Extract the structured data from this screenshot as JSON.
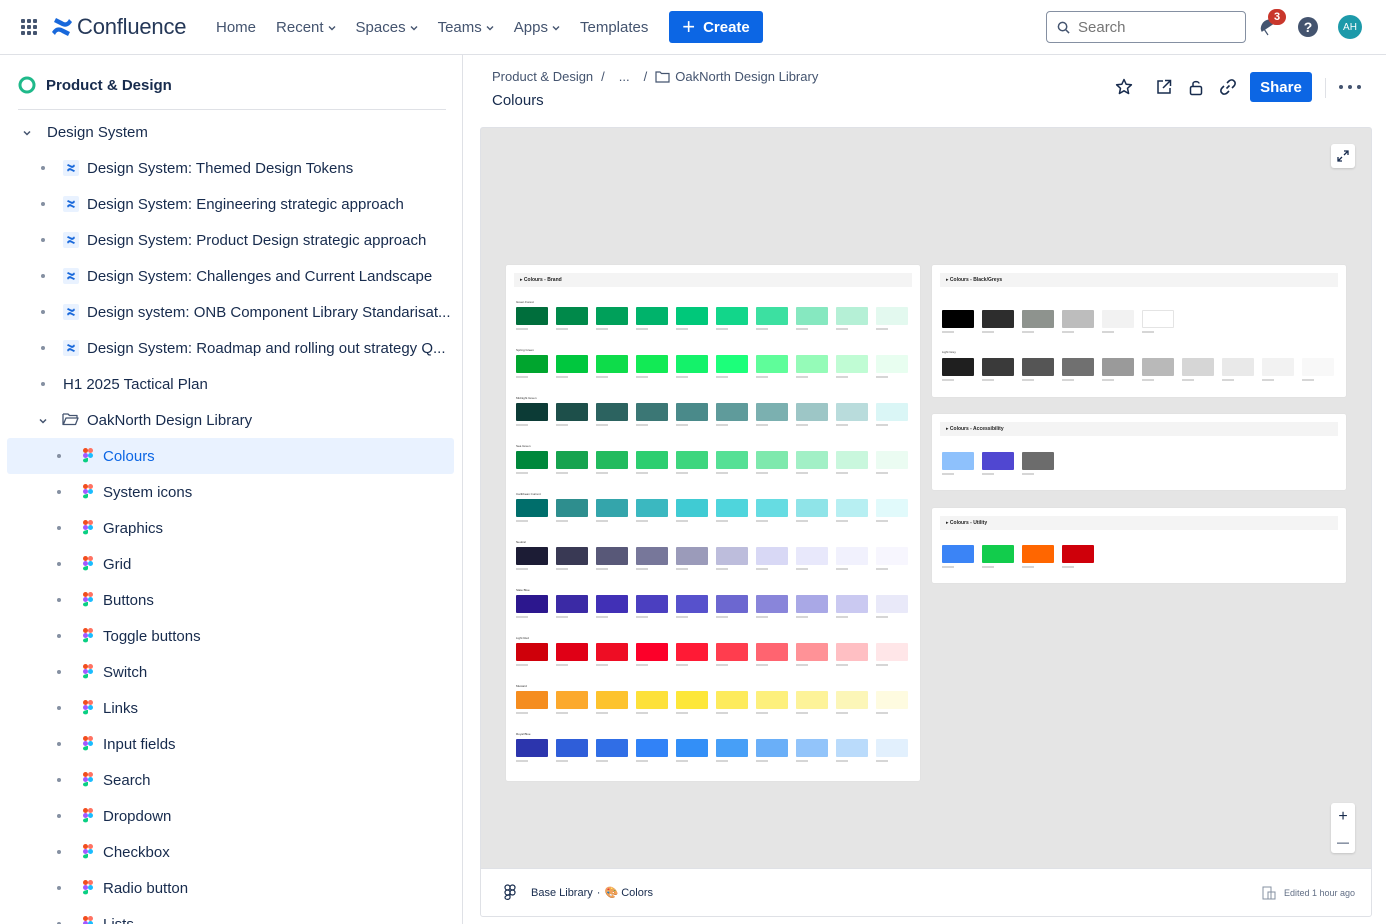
{
  "topnav": {
    "logo_text": "Confluence",
    "items": [
      {
        "label": "Home",
        "has_dropdown": false
      },
      {
        "label": "Recent",
        "has_dropdown": true
      },
      {
        "label": "Spaces",
        "has_dropdown": true
      },
      {
        "label": "Teams",
        "has_dropdown": true
      },
      {
        "label": "Apps",
        "has_dropdown": true
      },
      {
        "label": "Templates",
        "has_dropdown": false
      }
    ],
    "create_label": "Create",
    "search_placeholder": "Search",
    "notification_count": "3",
    "help_label": "?",
    "avatar_initials": "AH",
    "accent": "#0c66e4"
  },
  "sidebar": {
    "space_title": "Product & Design",
    "tree": [
      {
        "label": "Design System",
        "level": 0,
        "type": "expander-open",
        "icon": "chevron-down-icon"
      },
      {
        "label": "Design System: Themed Design Tokens",
        "level": 1,
        "type": "confluence"
      },
      {
        "label": "Design System: Engineering strategic approach",
        "level": 1,
        "type": "confluence"
      },
      {
        "label": "Design System: Product Design strategic approach",
        "level": 1,
        "type": "confluence"
      },
      {
        "label": "Design System: Challenges and Current Landscape",
        "level": 1,
        "type": "confluence"
      },
      {
        "label": "Design system: ONB Component Library Standarisat...",
        "level": 1,
        "type": "confluence"
      },
      {
        "label": "Design System: Roadmap and rolling out strategy Q...",
        "level": 1,
        "type": "confluence"
      },
      {
        "label": "H1 2025 Tactical Plan",
        "level": 1,
        "type": "page"
      },
      {
        "label": "OakNorth Design Library",
        "level": 1,
        "type": "folder-open"
      },
      {
        "label": "Colours",
        "level": 2,
        "type": "figma",
        "selected": true
      },
      {
        "label": "System icons",
        "level": 2,
        "type": "figma"
      },
      {
        "label": "Graphics",
        "level": 2,
        "type": "figma"
      },
      {
        "label": "Grid",
        "level": 2,
        "type": "figma"
      },
      {
        "label": "Buttons",
        "level": 2,
        "type": "figma"
      },
      {
        "label": "Toggle buttons",
        "level": 2,
        "type": "figma"
      },
      {
        "label": "Switch",
        "level": 2,
        "type": "figma"
      },
      {
        "label": "Links",
        "level": 2,
        "type": "figma"
      },
      {
        "label": "Input fields",
        "level": 2,
        "type": "figma"
      },
      {
        "label": "Search",
        "level": 2,
        "type": "figma"
      },
      {
        "label": "Dropdown",
        "level": 2,
        "type": "figma"
      },
      {
        "label": "Checkbox",
        "level": 2,
        "type": "figma"
      },
      {
        "label": "Radio button",
        "level": 2,
        "type": "figma"
      },
      {
        "label": "Lists",
        "level": 2,
        "type": "figma"
      }
    ]
  },
  "main": {
    "breadcrumb": [
      "Product & Design",
      "...",
      "OakNorth Design Library"
    ],
    "page_title": "Colours",
    "share_label": "Share"
  },
  "embed": {
    "footer_file": "Base Library",
    "footer_page": "🎨 Colors",
    "edited_label": "Edited 1 hour ago",
    "zoom_in_label": "+",
    "zoom_out_label": "—",
    "brand_panel": {
      "title": "Colours - Brand",
      "rows": [
        {
          "name": "Green Forest",
          "colors": [
            "#006e3c",
            "#00894a",
            "#00a05a",
            "#00b36b",
            "#00c87a",
            "#12d68a",
            "#3ce0a1",
            "#86e8c0",
            "#b5f0d6",
            "#e3f9ef"
          ]
        },
        {
          "name": "Spring Green",
          "colors": [
            "#00a52e",
            "#00c73e",
            "#0edc4a",
            "#12ea55",
            "#14f26a",
            "#1cff7a",
            "#5ffd9a",
            "#95fbb8",
            "#c0fcd4",
            "#e8fef0"
          ]
        },
        {
          "name": "Midnight Green",
          "colors": [
            "#0c3b36",
            "#1d4f4a",
            "#2c6360",
            "#3b7775",
            "#4a8a8a",
            "#5f9b9b",
            "#7bb0b0",
            "#9dc6c6",
            "#b9dcdc",
            "#daf6f6"
          ]
        },
        {
          "name": "Sea Green",
          "colors": [
            "#00873b",
            "#16a34f",
            "#22bb5e",
            "#2dce70",
            "#3ed67e",
            "#55e095",
            "#7ee9ad",
            "#a2f0c6",
            "#c9f7dd",
            "#ebfcf2"
          ]
        },
        {
          "name": "Caribbean Current",
          "colors": [
            "#006e6b",
            "#2e8e8e",
            "#34a5ab",
            "#3bb8c0",
            "#40cbd3",
            "#4fd5dc",
            "#66dce2",
            "#8fe4e8",
            "#b7eff2",
            "#e1fafb"
          ]
        },
        {
          "name": "Neutral",
          "colors": [
            "#1c1c35",
            "#393954",
            "#585878",
            "#77779a",
            "#9b9bba",
            "#bdbddc",
            "#d8d8f5",
            "#e8e8fb",
            "#f1f1fd",
            "#f7f6fe"
          ]
        },
        {
          "name": "Slate Blue",
          "colors": [
            "#2c178e",
            "#3b2aa5",
            "#4130b6",
            "#4b3fc0",
            "#5751cc",
            "#6c67d0",
            "#8985da",
            "#a9a8e6",
            "#cac9f1",
            "#e9e9f9"
          ]
        },
        {
          "name": "Light Red",
          "colors": [
            "#cf000a",
            "#e00016",
            "#ee0d24",
            "#fc0029",
            "#ff1a35",
            "#ff3d4e",
            "#ff6470",
            "#ff9297",
            "#ffbfc3",
            "#ffe6e8"
          ]
        },
        {
          "name": "Mustard",
          "colors": [
            "#f58d1f",
            "#fca92d",
            "#fdc32e",
            "#fde13a",
            "#fde739",
            "#fdeb5c",
            "#fdf07c",
            "#fdf399",
            "#fcf6b8",
            "#fefbe0"
          ]
        },
        {
          "name": "Royal Blue",
          "colors": [
            "#2c35ad",
            "#2f5ed9",
            "#306ee6",
            "#3182f7",
            "#338ff7",
            "#479ff7",
            "#6aaff8",
            "#92c4fa",
            "#badbfb",
            "#e2f0fd"
          ]
        }
      ]
    },
    "greys_panel": {
      "title": "Colours - Black/Greys",
      "row1": [
        "#000000",
        "#2d2d2d",
        "#8e938e",
        "#bdbdbd",
        "#f2f2f2",
        "#ffffff"
      ],
      "row1_name": "Light Grey",
      "row2": [
        "#1f1f1f",
        "#3a3a3a",
        "#555555",
        "#707070",
        "#9a9a9a",
        "#b9b9b9",
        "#d6d6d6",
        "#e9e9e9",
        "#f2f2f2",
        "#f8f8f8"
      ]
    },
    "access_panel": {
      "title": "Colours - Accessibility",
      "colors": [
        "#8ec1fc",
        "#5047d1",
        "#6c6c6c"
      ]
    },
    "utility_panel": {
      "title": "Colours - Utility",
      "colors": [
        "#3b84f6",
        "#12cc4c",
        "#ff6600",
        "#cf000a"
      ]
    }
  }
}
